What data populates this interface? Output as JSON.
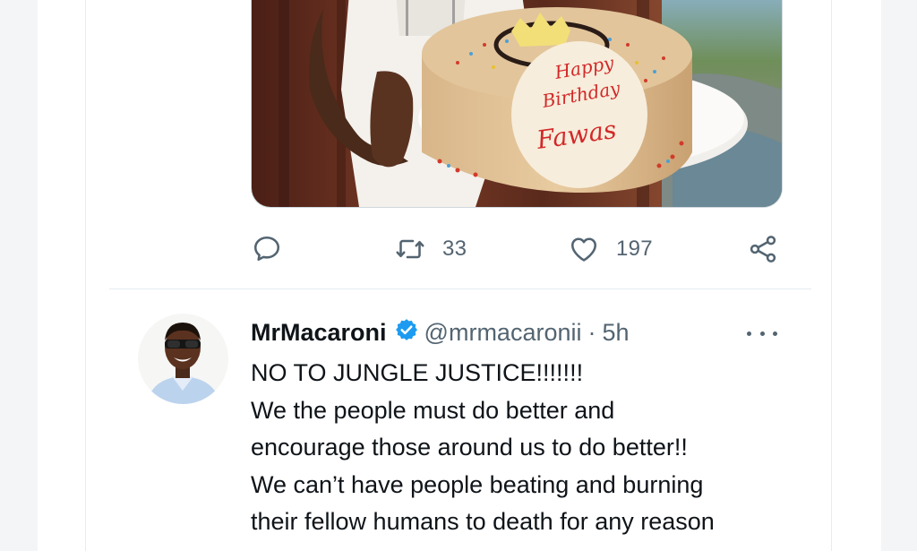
{
  "previous_tweet": {
    "media": {
      "description_icon": "cake-photo",
      "cake_text": [
        "Happy",
        "Birthday",
        "Fawas"
      ]
    },
    "actions": {
      "reply_icon": "reply-icon",
      "retweet_icon": "retweet-icon",
      "retweet_count": "33",
      "like_icon": "heart-icon",
      "like_count": "197",
      "share_icon": "share-icon"
    }
  },
  "tweet": {
    "display_name": "MrMacaroni",
    "verified_icon": "verified-badge-icon",
    "handle": "@mrmacaronii",
    "separator": "·",
    "timestamp": "5h",
    "more_icon": "more-icon",
    "text_lines": [
      "NO TO JUNGLE JUSTICE!!!!!!!",
      "We the people must do better and",
      "encourage those around us to do better!!",
      "We can’t have people beating and burning",
      "their fellow humans to death for any reason"
    ]
  },
  "colors": {
    "text_primary": "#0f1419",
    "text_secondary": "#536471",
    "verified_blue": "#1d9bf0",
    "divider": "#e6ecf0"
  }
}
